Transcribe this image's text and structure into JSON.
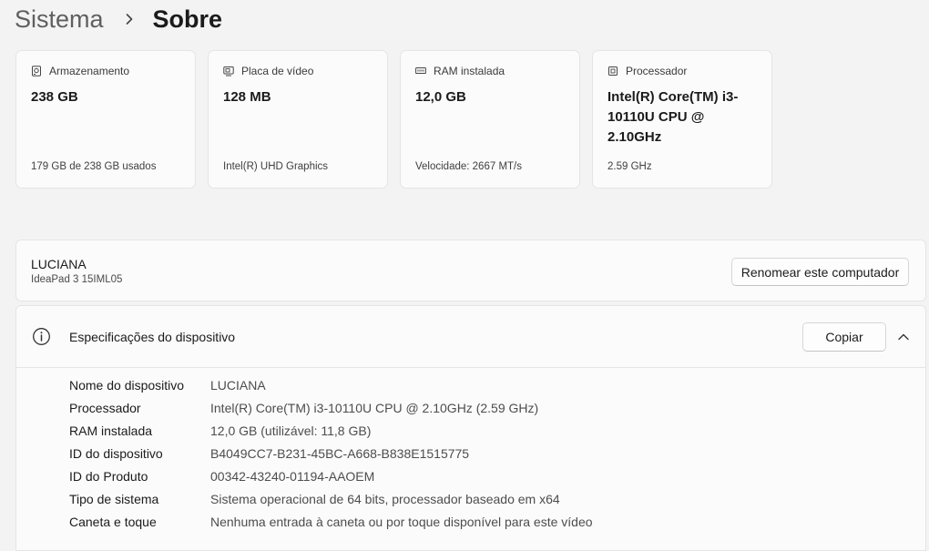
{
  "breadcrumb": {
    "parent": "Sistema",
    "current": "Sobre"
  },
  "cards": [
    {
      "icon": "storage-icon",
      "title": "Armazenamento",
      "value": "238 GB",
      "sub": "179 GB de 238 GB usados"
    },
    {
      "icon": "display-adapter-icon",
      "title": "Placa de vídeo",
      "value": "128 MB",
      "sub": "Intel(R) UHD Graphics"
    },
    {
      "icon": "ram-icon",
      "title": "RAM instalada",
      "value": "12,0 GB",
      "sub": "Velocidade: 2667 MT/s"
    },
    {
      "icon": "processor-icon",
      "title": "Processador",
      "value": "Intel(R) Core(TM) i3-10110U CPU @ 2.10GHz",
      "sub": "2.59 GHz"
    }
  ],
  "device": {
    "name": "LUCIANA",
    "model": "IdeaPad 3 15IML05",
    "rename_label": "Renomear este computador"
  },
  "specs": {
    "title": "Especificações do dispositivo",
    "copy_label": "Copiar",
    "rows": [
      {
        "label": "Nome do dispositivo",
        "value": "LUCIANA"
      },
      {
        "label": "Processador",
        "value": "Intel(R) Core(TM) i3-10110U CPU @ 2.10GHz (2.59 GHz)"
      },
      {
        "label": "RAM instalada",
        "value": "12,0 GB (utilizável: 11,8 GB)"
      },
      {
        "label": "ID do dispositivo",
        "value": "B4049CC7-B231-45BC-A668-B838E1515775"
      },
      {
        "label": "ID do Produto",
        "value": "00342-43240-01194-AAOEM"
      },
      {
        "label": "Tipo de sistema",
        "value": "Sistema operacional de 64 bits, processador baseado em x64"
      },
      {
        "label": "Caneta e toque",
        "value": "Nenhuma entrada à caneta ou por toque disponível para este vídeo"
      }
    ]
  }
}
